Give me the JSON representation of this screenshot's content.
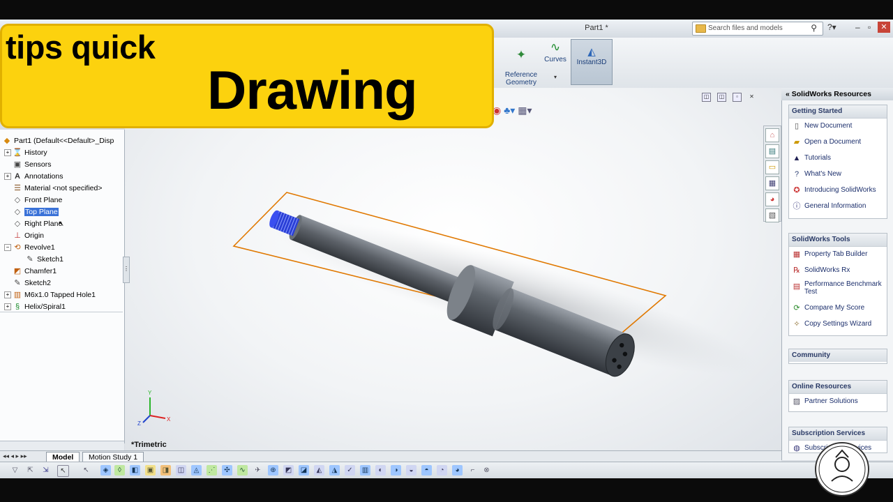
{
  "window": {
    "doc_title": "Part1 *",
    "search_placeholder": "Search files and models"
  },
  "ribbon": {
    "reference_geometry": "Reference\nGeometry",
    "curves": "Curves",
    "instant3d": "Instant3D"
  },
  "banner": {
    "line1": "tips quick",
    "line2": "Drawing"
  },
  "tree": {
    "root": "Part1  (Default<<Default>_Disp",
    "items": [
      {
        "label": "History",
        "icon": "history-icon"
      },
      {
        "label": "Sensors",
        "icon": "sensors-icon"
      },
      {
        "label": "Annotations",
        "icon": "annotations-icon"
      },
      {
        "label": "Material <not specified>",
        "icon": "material-icon"
      },
      {
        "label": "Front Plane",
        "icon": "plane-icon"
      },
      {
        "label": "Top Plane",
        "icon": "plane-icon",
        "selected": true
      },
      {
        "label": "Right Plane",
        "icon": "plane-icon"
      },
      {
        "label": "Origin",
        "icon": "origin-icon"
      },
      {
        "label": "Revolve1",
        "icon": "revolve-icon"
      },
      {
        "label": "Sketch1",
        "icon": "sketch-icon"
      },
      {
        "label": "Chamfer1",
        "icon": "chamfer-icon"
      },
      {
        "label": "Sketch2",
        "icon": "sketch-icon"
      },
      {
        "label": "M6x1.0 Tapped Hole1",
        "icon": "hole-icon"
      },
      {
        "label": "Helix/Spiral1",
        "icon": "helix-icon"
      }
    ]
  },
  "viewport": {
    "view_name": "*Trimetric"
  },
  "taskpane": {
    "title": "SolidWorks Resources",
    "getting_started": {
      "header": "Getting Started",
      "items": [
        "New Document",
        "Open a Document",
        "Tutorials",
        "What's New",
        "Introducing SolidWorks",
        "General Information"
      ]
    },
    "tools": {
      "header": "SolidWorks Tools",
      "items": [
        "Property Tab Builder",
        "SolidWorks Rx",
        "Performance Benchmark Test",
        "Compare My Score",
        "Copy Settings Wizard"
      ]
    },
    "community": "Community",
    "online": {
      "header": "Online Resources",
      "items": [
        "Partner Solutions"
      ]
    },
    "subscription": {
      "header": "Subscription Services",
      "items": [
        "Subscription Services"
      ]
    }
  },
  "bottom": {
    "tab_model": "Model",
    "tab_motion": "Motion Study 1"
  },
  "colors": {
    "banner": "#fcd20e",
    "selection": "#3a72d8",
    "part": "#5a5f66",
    "thread": "#2a3fd6",
    "plane": "#e07800"
  }
}
